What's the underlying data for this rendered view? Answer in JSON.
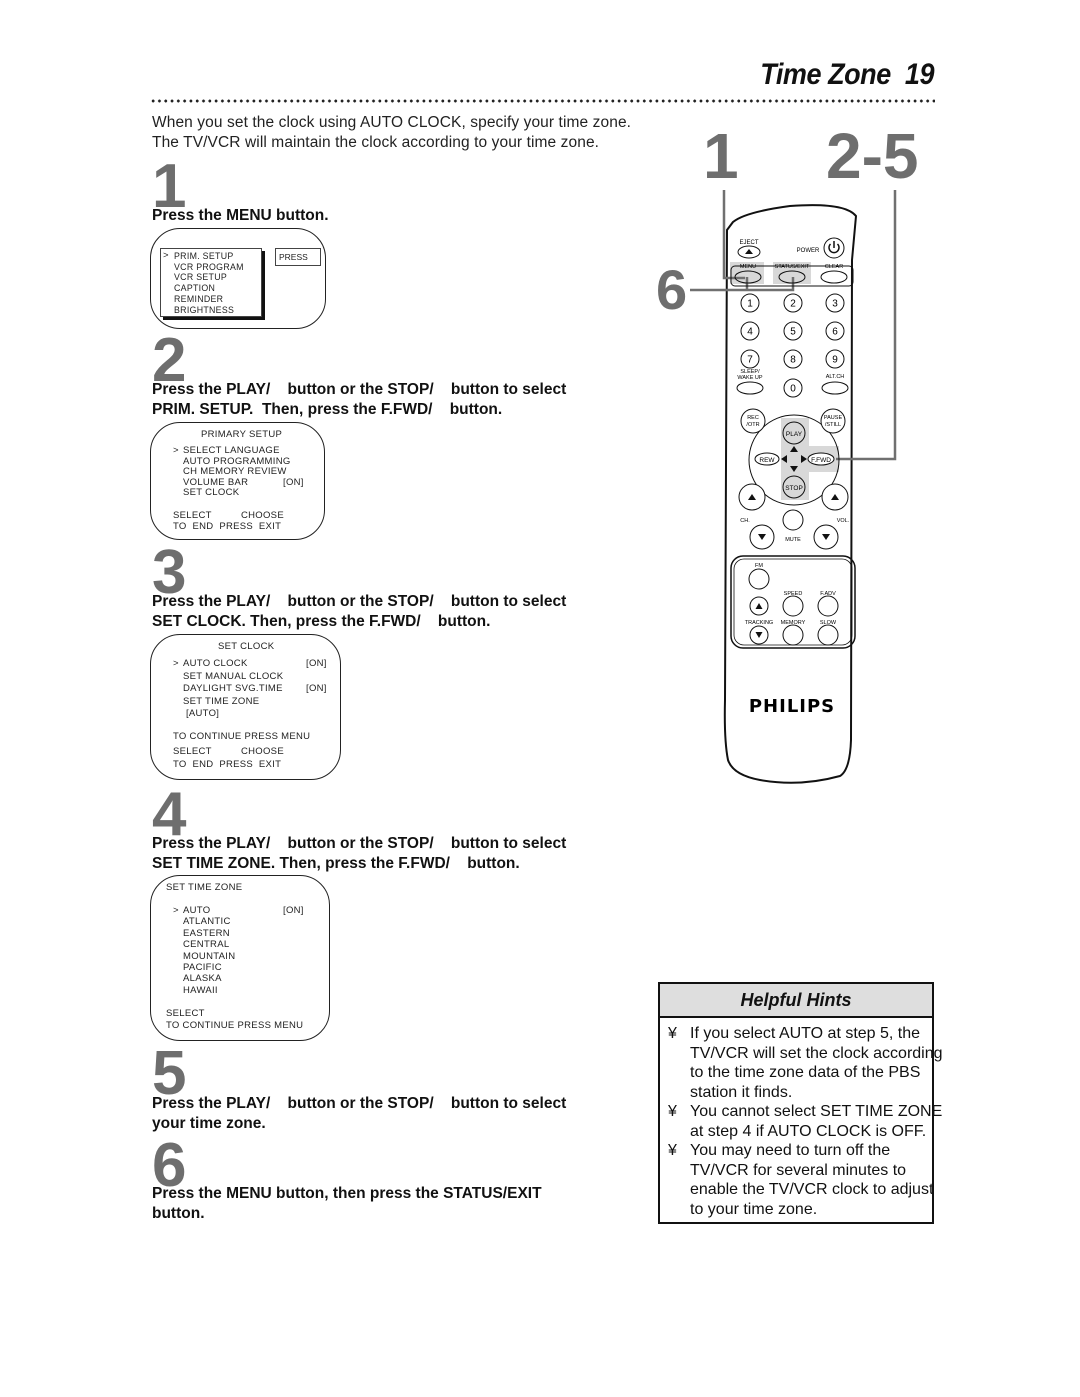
{
  "header": {
    "title": "Time Zone",
    "page_number": "19"
  },
  "intro": {
    "line1": "When you set the clock using AUTO CLOCK, specify your time zone.",
    "line2": "The TV/VCR will maintain the clock according to your time zone."
  },
  "steps": [
    {
      "number": "1",
      "lines": [
        "Press the MENU button."
      ],
      "screen": {
        "menu_items": [
          "PRIM. SETUP",
          "VCR PROGRAM",
          "VCR SETUP",
          "CAPTION",
          "REMINDER",
          "BRIGHTNESS"
        ],
        "cursor": ">",
        "press_label": "PRESS"
      }
    },
    {
      "number": "2",
      "lines": [
        "Press the PLAY/    button or the STOP/    button to select",
        "PRIM. SETUP.  Then, press the F.FWD/    button."
      ],
      "screen": {
        "title": "PRIMARY SETUP",
        "cursor": ">",
        "items": [
          {
            "label": "SELECT LANGUAGE",
            "value": ""
          },
          {
            "label": "AUTO PROGRAMMING",
            "value": ""
          },
          {
            "label": "CH MEMORY REVIEW",
            "value": ""
          },
          {
            "label": "VOLUME BAR",
            "value": "[ON]"
          },
          {
            "label": "SET CLOCK",
            "value": ""
          }
        ],
        "footer1": "SELECT          CHOOSE",
        "footer2": "TO  END  PRESS  EXIT"
      }
    },
    {
      "number": "3",
      "lines": [
        "Press the PLAY/    button or the STOP/    button to select",
        "SET CLOCK. Then, press the F.FWD/    button."
      ],
      "screen": {
        "title": "SET CLOCK",
        "cursor": ">",
        "items": [
          {
            "label": "AUTO CLOCK",
            "value": "[ON]"
          },
          {
            "label": "SET MANUAL CLOCK",
            "value": ""
          },
          {
            "label": "DAYLIGHT SVG.TIME",
            "value": "[ON]"
          },
          {
            "label": "SET TIME ZONE",
            "value": ""
          },
          {
            "label": " [AUTO]",
            "value": ""
          }
        ],
        "continue": "TO CONTINUE PRESS MENU",
        "footer1": "SELECT          CHOOSE",
        "footer2": "TO  END  PRESS  EXIT"
      }
    },
    {
      "number": "4",
      "lines": [
        "Press the PLAY/    button or the STOP/    button to select",
        "SET TIME ZONE. Then, press the F.FWD/    button."
      ],
      "screen": {
        "title": "SET TIME ZONE",
        "cursor": ">",
        "items": [
          {
            "label": "AUTO",
            "value": "[ON]"
          },
          {
            "label": "ATLANTIC",
            "value": ""
          },
          {
            "label": "EASTERN",
            "value": ""
          },
          {
            "label": "CENTRAL",
            "value": ""
          },
          {
            "label": "MOUNTAIN",
            "value": ""
          },
          {
            "label": "PACIFIC",
            "value": ""
          },
          {
            "label": "ALASKA",
            "value": ""
          },
          {
            "label": "HAWAII",
            "value": ""
          }
        ],
        "footer1": "SELECT",
        "footer2": "TO CONTINUE PRESS MENU"
      }
    },
    {
      "number": "5",
      "lines": [
        "Press the PLAY/    button or the STOP/    button to select",
        "your time zone."
      ]
    },
    {
      "number": "6",
      "lines": [
        "Press the MENU button, then press the STATUS/EXIT",
        "button."
      ]
    }
  ],
  "remote": {
    "callouts": {
      "left": "1",
      "right": "2-5",
      "side": "6"
    },
    "labels": {
      "eject": "EJECT",
      "power": "POWER",
      "menu": "MENU",
      "status_exit": "STATUS/EXIT",
      "clear": "CLEAR",
      "digits": [
        "1",
        "2",
        "3",
        "4",
        "5",
        "6",
        "7",
        "8",
        "9",
        "0"
      ],
      "sleep": "SLEEP/",
      "wake_up": "WAKE UP",
      "alt_ch": "ALT.CH",
      "rec": "REC",
      "otr": "/OTR",
      "pause": "PAUSE",
      "still": "/STILL",
      "play": "PLAY",
      "rew": "REW",
      "ffwd": "F.FWD",
      "stop": "STOP",
      "ch": "CH.",
      "vol": "VOL.",
      "mute": "MUTE",
      "fm": "FM",
      "speed": "SPEED",
      "fadv": "F.ADV",
      "tracking": "TRACKING",
      "memory": "MEMORY",
      "slow": "SLOW",
      "brand": "PHILIPS"
    },
    "highlight_color": "#d8d8d8",
    "callout_line_color": "#707070"
  },
  "hints": {
    "title": "Helpful Hints",
    "bullet": "¥",
    "items": [
      [
        "If you select AUTO at step 5, the",
        "TV/VCR will set the clock according",
        "to the time zone data of the PBS",
        "station it finds."
      ],
      [
        "You cannot select SET TIME ZONE",
        "at step 4 if AUTO CLOCK is OFF."
      ],
      [
        "You may need to turn off the",
        "TV/VCR for several minutes to",
        "enable the TV/VCR clock to adjust",
        "to your time zone."
      ]
    ]
  }
}
